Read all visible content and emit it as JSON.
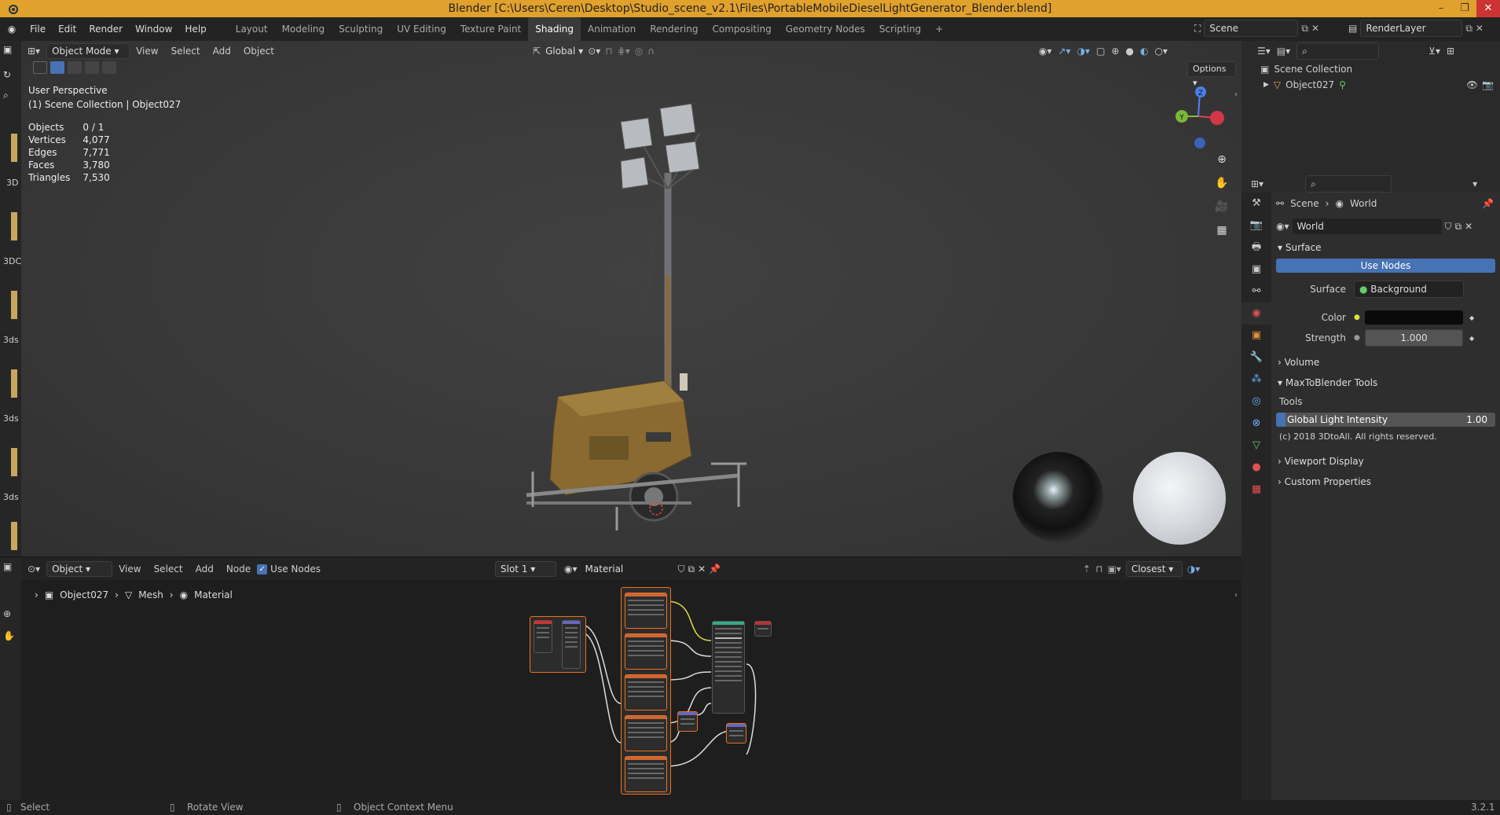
{
  "window": {
    "title": "Blender [C:\\Users\\Ceren\\Desktop\\Studio_scene_v2.1\\Files\\PortableMobileDieselLightGenerator_Blender.blend]"
  },
  "menu": [
    "File",
    "Edit",
    "Render",
    "Window",
    "Help"
  ],
  "workspaces": [
    "Layout",
    "Modeling",
    "Sculpting",
    "UV Editing",
    "Texture Paint",
    "Shading",
    "Animation",
    "Rendering",
    "Compositing",
    "Geometry Nodes",
    "Scripting"
  ],
  "active_workspace": "Shading",
  "scene": {
    "name": "Scene",
    "render_layer": "RenderLayer"
  },
  "viewport": {
    "mode": "Object Mode",
    "menus": [
      "View",
      "Select",
      "Add",
      "Object"
    ],
    "orientation": "Global",
    "options_label": "Options",
    "perspective": "User Perspective",
    "collection_line": "(1) Scene Collection | Object027",
    "stats": [
      {
        "label": "Objects",
        "value": "0 / 1"
      },
      {
        "label": "Vertices",
        "value": "4,077"
      },
      {
        "label": "Edges",
        "value": "7,771"
      },
      {
        "label": "Faces",
        "value": "3,780"
      },
      {
        "label": "Triangles",
        "value": "7,530"
      }
    ],
    "gizmo": {
      "z": "Z",
      "y": "Y"
    }
  },
  "left_strip_labels": [
    "3D",
    "3DC",
    "3ds",
    "3ds",
    "3ds"
  ],
  "outliner": {
    "collection": "Scene Collection",
    "object": "Object027"
  },
  "properties": {
    "breadcrumb": {
      "scene": "Scene",
      "world": "World"
    },
    "world_name": "World",
    "surface_panel": "Surface",
    "use_nodes_button": "Use Nodes",
    "surface_label": "Surface",
    "surface_value": "Background",
    "color_label": "Color",
    "strength_label": "Strength",
    "strength_value": "1.000",
    "volume_panel": "Volume",
    "max_panel": "MaxToBlender Tools",
    "tools_label": "Tools",
    "gli_label": "Global Light Intensity",
    "gli_value": "1.00",
    "copyright": "(c) 2018 3DtoAll. All rights reserved.",
    "viewport_display": "Viewport Display",
    "custom_props": "Custom Properties"
  },
  "node_editor": {
    "object_mode": "Object",
    "menus": [
      "View",
      "Select",
      "Add",
      "Node"
    ],
    "use_nodes": "Use Nodes",
    "slot": "Slot 1",
    "material": "Material",
    "closest": "Closest",
    "breadcrumb": {
      "object": "Object027",
      "mesh": "Mesh",
      "material": "Material"
    }
  },
  "status": {
    "select": "Select",
    "rotate": "Rotate View",
    "context": "Object Context Menu",
    "version": "3.2.1"
  }
}
